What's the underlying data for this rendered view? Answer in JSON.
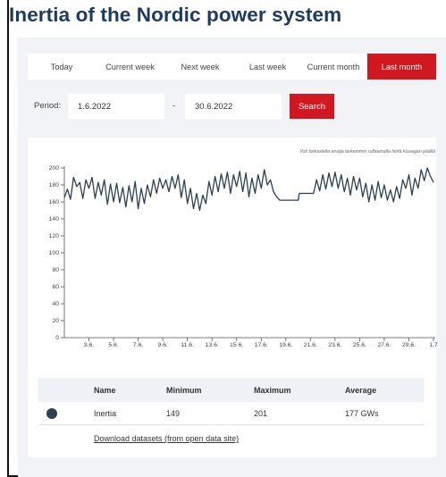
{
  "title": "Inertia of the Nordic power system",
  "tabs": [
    {
      "label": "Today",
      "active": false
    },
    {
      "label": "Current week",
      "active": false
    },
    {
      "label": "Next week",
      "active": false
    },
    {
      "label": "Last week",
      "active": false
    },
    {
      "label": "Current month",
      "active": false
    },
    {
      "label": "Last month",
      "active": true
    }
  ],
  "period": {
    "label": "Period:",
    "start": "1.6.2022",
    "separator": "-",
    "end": "30.6.2022",
    "search_label": "Search"
  },
  "chart_hint": "Voit tarkastella arvoja tarkemmin rullaamalla hiirtä kuvaajan päällä",
  "chart_data": {
    "type": "line",
    "title": "",
    "xlabel": "",
    "ylabel": "",
    "ylim": [
      0,
      200
    ],
    "yticks": [
      0,
      20,
      40,
      60,
      80,
      100,
      120,
      140,
      160,
      180,
      200
    ],
    "xticks": [
      "3.6.",
      "5.6.",
      "7.6.",
      "9.6.",
      "11.6.",
      "13.6.",
      "15.6.",
      "17.6.",
      "19.6.",
      "21.6.",
      "23.6.",
      "25.6.",
      "27.6.",
      "29.6.",
      "1.7"
    ],
    "x_start_day": 1,
    "x_end_day": 31,
    "grid": false,
    "series": [
      {
        "name": "Inertia",
        "color": "#2d4150",
        "values": [
          [
            1.0,
            165
          ],
          [
            1.25,
            175
          ],
          [
            1.5,
            163
          ],
          [
            1.75,
            189
          ],
          [
            2.0,
            178
          ],
          [
            2.25,
            183
          ],
          [
            2.5,
            164
          ],
          [
            2.75,
            186
          ],
          [
            3.0,
            176
          ],
          [
            3.25,
            189
          ],
          [
            3.5,
            164
          ],
          [
            3.75,
            183
          ],
          [
            4.0,
            168
          ],
          [
            4.25,
            186
          ],
          [
            4.5,
            157
          ],
          [
            4.75,
            181
          ],
          [
            5.0,
            160
          ],
          [
            5.25,
            182
          ],
          [
            5.5,
            159
          ],
          [
            5.75,
            177
          ],
          [
            6.0,
            154
          ],
          [
            6.25,
            179
          ],
          [
            6.5,
            160
          ],
          [
            6.75,
            184
          ],
          [
            7.0,
            152
          ],
          [
            7.25,
            176
          ],
          [
            7.5,
            158
          ],
          [
            7.75,
            180
          ],
          [
            8.0,
            166
          ],
          [
            8.25,
            186
          ],
          [
            8.5,
            170
          ],
          [
            8.75,
            188
          ],
          [
            9.0,
            176
          ],
          [
            9.25,
            186
          ],
          [
            9.5,
            172
          ],
          [
            9.75,
            190
          ],
          [
            10.0,
            176
          ],
          [
            10.25,
            192
          ],
          [
            10.5,
            165
          ],
          [
            10.75,
            186
          ],
          [
            11.0,
            158
          ],
          [
            11.25,
            176
          ],
          [
            11.5,
            152
          ],
          [
            11.75,
            170
          ],
          [
            12.0,
            150
          ],
          [
            12.25,
            168
          ],
          [
            12.5,
            158
          ],
          [
            12.75,
            184
          ],
          [
            13.0,
            168
          ],
          [
            13.25,
            190
          ],
          [
            13.5,
            172
          ],
          [
            13.75,
            193
          ],
          [
            14.0,
            176
          ],
          [
            14.25,
            195
          ],
          [
            14.5,
            170
          ],
          [
            14.75,
            192
          ],
          [
            15.0,
            178
          ],
          [
            15.25,
            196
          ],
          [
            15.5,
            172
          ],
          [
            15.75,
            194
          ],
          [
            16.0,
            166
          ],
          [
            16.25,
            188
          ],
          [
            16.5,
            170
          ],
          [
            16.75,
            192
          ],
          [
            17.0,
            176
          ],
          [
            17.25,
            198
          ],
          [
            17.5,
            180
          ],
          [
            17.75,
            186
          ],
          [
            18.0,
            172
          ],
          [
            18.25,
            166
          ],
          [
            18.5,
            162
          ],
          [
            18.75,
            162
          ],
          [
            19.0,
            162
          ],
          [
            19.25,
            162
          ],
          [
            19.5,
            162
          ],
          [
            19.75,
            162
          ],
          [
            20.0,
            162
          ],
          [
            20.1,
            170
          ],
          [
            20.25,
            170
          ],
          [
            20.5,
            170
          ],
          [
            20.75,
            170
          ],
          [
            21.0,
            170
          ],
          [
            21.25,
            170
          ],
          [
            21.5,
            186
          ],
          [
            21.75,
            173
          ],
          [
            22.0,
            192
          ],
          [
            22.25,
            175
          ],
          [
            22.5,
            194
          ],
          [
            22.75,
            178
          ],
          [
            23.0,
            195
          ],
          [
            23.25,
            176
          ],
          [
            23.5,
            192
          ],
          [
            23.75,
            172
          ],
          [
            24.0,
            188
          ],
          [
            24.25,
            168
          ],
          [
            24.5,
            190
          ],
          [
            24.75,
            174
          ],
          [
            25.0,
            188
          ],
          [
            25.25,
            166
          ],
          [
            25.5,
            182
          ],
          [
            25.75,
            160
          ],
          [
            26.0,
            180
          ],
          [
            26.25,
            162
          ],
          [
            26.5,
            184
          ],
          [
            26.75,
            165
          ],
          [
            27.0,
            180
          ],
          [
            27.25,
            162
          ],
          [
            27.5,
            174
          ],
          [
            27.75,
            160
          ],
          [
            28.0,
            178
          ],
          [
            28.25,
            164
          ],
          [
            28.5,
            186
          ],
          [
            28.75,
            176
          ],
          [
            29.0,
            192
          ],
          [
            29.25,
            168
          ],
          [
            29.5,
            188
          ],
          [
            29.75,
            176
          ],
          [
            30.0,
            198
          ],
          [
            30.25,
            185
          ],
          [
            30.5,
            200
          ],
          [
            30.75,
            190
          ],
          [
            31.0,
            183
          ]
        ]
      }
    ]
  },
  "table": {
    "headers": [
      "Name",
      "Minimum",
      "Maximum",
      "Average"
    ],
    "row": {
      "name": "Inertia",
      "min": "149",
      "max": "201",
      "avg": "177 GWs",
      "color": "#2d4150"
    },
    "download_label": "Download datasets (from open data site)"
  }
}
